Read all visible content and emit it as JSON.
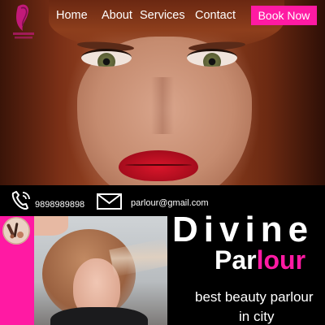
{
  "nav": {
    "items": [
      {
        "label": "Home"
      },
      {
        "label": "About"
      },
      {
        "label": "Services"
      },
      {
        "label": "Contact"
      }
    ],
    "cta_label": "Book Now"
  },
  "contact": {
    "phone": "9898989898",
    "email": "parlour@gmail.com"
  },
  "headline": {
    "line1": "Divine",
    "line2_part1": "Par",
    "line2_part2": "lour"
  },
  "tagline": {
    "line1": "best beauty parlour",
    "line2": "in city"
  },
  "colors": {
    "accent": "#ff1aa3",
    "background": "#000000",
    "text": "#ffffff"
  },
  "icons": {
    "logo": "salon-logo-icon",
    "phone": "phone-icon",
    "mail": "mail-icon",
    "badge": "makeup-tools-icon"
  }
}
